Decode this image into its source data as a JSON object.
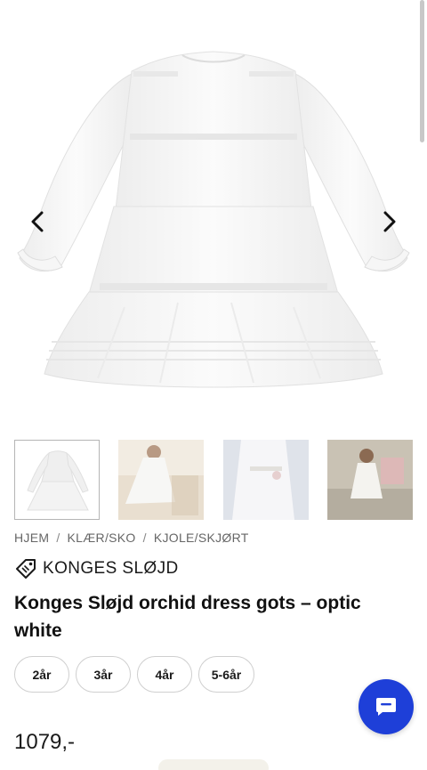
{
  "gallery": {
    "prev_icon": "chevron-left-icon",
    "next_icon": "chevron-right-icon",
    "thumbnails": [
      {
        "alt": "dress-front"
      },
      {
        "alt": "girl-twirling"
      },
      {
        "alt": "dress-detail"
      },
      {
        "alt": "girl-on-street"
      }
    ]
  },
  "breadcrumb": {
    "items": [
      "HJEM",
      "KLÆR/SKO",
      "KJOLE/SKJØRT"
    ],
    "separator": "/"
  },
  "brand": {
    "icon": "tag-icon",
    "name": "KONGES SLØJD"
  },
  "product": {
    "title": "Konges Sløjd orchid dress gots – optic white",
    "sizes": [
      "2år",
      "3år",
      "4år",
      "5-6år"
    ],
    "price": "1079,-"
  },
  "chat": {
    "icon": "chat-bubble-icon",
    "color": "#1e3fd8"
  }
}
